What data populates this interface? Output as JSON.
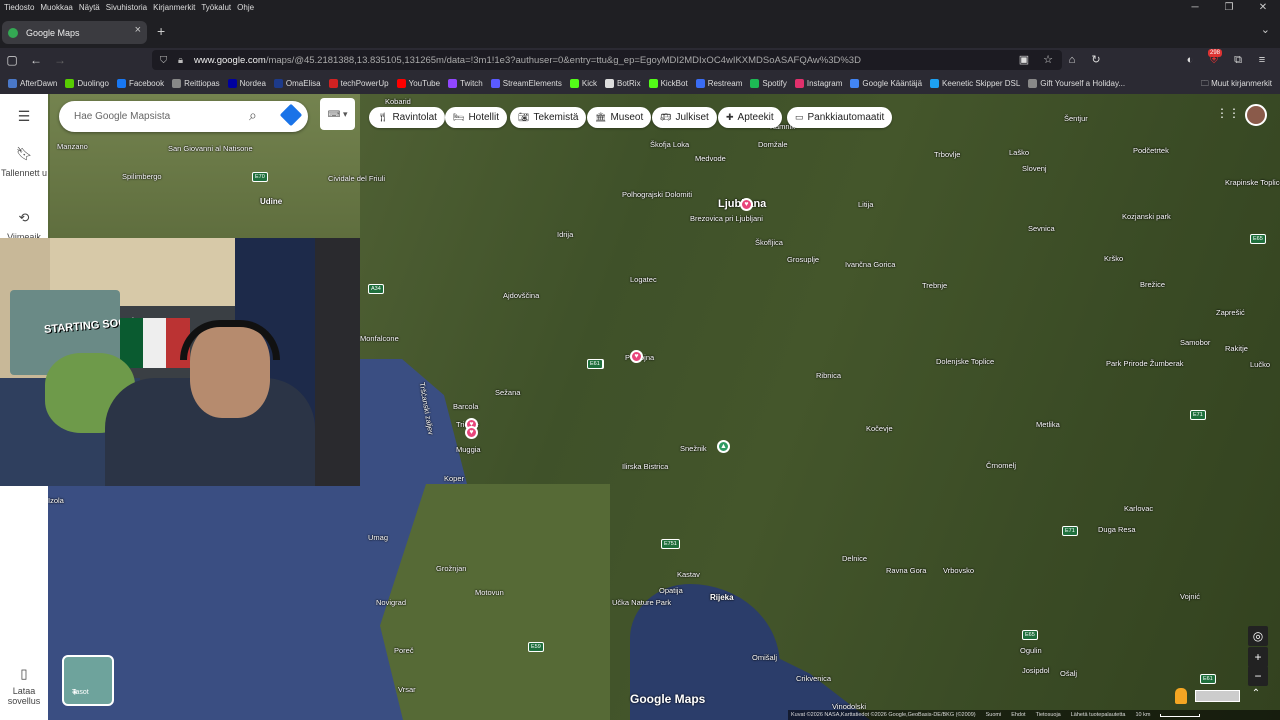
{
  "menubar": {
    "items": [
      "Tiedosto",
      "Muokkaa",
      "Näytä",
      "Sivuhistoria",
      "Kirjanmerkit",
      "Työkalut",
      "Ohje"
    ]
  },
  "window": {
    "minimize": "─",
    "restore": "❐",
    "close": "✕"
  },
  "tab": {
    "title": "Google Maps",
    "close": "×",
    "new_tab": "+",
    "list": "⌄"
  },
  "address": {
    "host": "www.google.com",
    "path": "/maps/@45.2181388,13.835105,131265m/data=!3m1!1e3?authuser=0&entry=ttu&g_ep=EgoyMDI2MDIxOC4wIKXMDSoASAFQAw%3D%3D"
  },
  "nav": {
    "badge": "298"
  },
  "bookmarks": {
    "items": [
      {
        "label": "AfterDawn",
        "color": "#4a78c8"
      },
      {
        "label": "Duolingo",
        "color": "#58cc02"
      },
      {
        "label": "Facebook",
        "color": "#1877f2"
      },
      {
        "label": "Reittiopas",
        "color": "#888888"
      },
      {
        "label": "Nordea",
        "color": "#0000a0"
      },
      {
        "label": "OmaElisa",
        "color": "#1d3a8a"
      },
      {
        "label": "techPowerUp",
        "color": "#d22222"
      },
      {
        "label": "YouTube",
        "color": "#ff0000"
      },
      {
        "label": "Twitch",
        "color": "#9146ff"
      },
      {
        "label": "StreamElements",
        "color": "#5a5aff"
      },
      {
        "label": "Kick",
        "color": "#53fc18"
      },
      {
        "label": "BotRix",
        "color": "#dddddd"
      },
      {
        "label": "KickBot",
        "color": "#53fc18"
      },
      {
        "label": "Restream",
        "color": "#3a6cf4"
      },
      {
        "label": "Spotify",
        "color": "#1db954"
      },
      {
        "label": "Instagram",
        "color": "#e1306c"
      },
      {
        "label": "Google Kääntäjä",
        "color": "#4285f4"
      },
      {
        "label": "Keenetic Skipper DSL",
        "color": "#1da1f2"
      },
      {
        "label": "Gift Yourself a Holiday...",
        "color": "#888888"
      }
    ],
    "other": "Muut kirjanmerkit"
  },
  "sidebar": {
    "menu": "☰",
    "saved": "Tallennett u",
    "recent": "Viimeaik",
    "app": "Lataa sovellus"
  },
  "search": {
    "placeholder": "Hae Google Mapsista"
  },
  "chips": [
    "Ravintolat",
    "Hotellit",
    "Tekemistä",
    "Museot",
    "Julkiset",
    "Apteekit",
    "Pankkiautomaatit"
  ],
  "map": {
    "places": [
      {
        "name": "Kobarid"
      },
      {
        "name": "Manzano"
      },
      {
        "name": "San Giovanni al Natisone"
      },
      {
        "name": "Spilimbergo"
      },
      {
        "name": "Udine"
      },
      {
        "name": "Cividale del Friuli"
      },
      {
        "name": "Ljubljana"
      },
      {
        "name": "Škofja Loka"
      },
      {
        "name": "Medvode"
      },
      {
        "name": "Domžale"
      },
      {
        "name": "Kamnik"
      },
      {
        "name": "Polhograjski Dolomiti"
      },
      {
        "name": "Brezovica pri Ljubljani"
      },
      {
        "name": "Idrija"
      },
      {
        "name": "Logatec"
      },
      {
        "name": "Škofljica"
      },
      {
        "name": "Grosuplje"
      },
      {
        "name": "Ivančna Gorica"
      },
      {
        "name": "Trebnje"
      },
      {
        "name": "Litija"
      },
      {
        "name": "Trbovlje"
      },
      {
        "name": "Šentjur"
      },
      {
        "name": "Laško"
      },
      {
        "name": "Podčetrtek"
      },
      {
        "name": "Krapinske Toplice"
      },
      {
        "name": "Kozjanski park"
      },
      {
        "name": "Sevnica"
      },
      {
        "name": "Krško"
      },
      {
        "name": "Brežice"
      },
      {
        "name": "Zaprešić"
      },
      {
        "name": "Samobor"
      },
      {
        "name": "Rakitje"
      },
      {
        "name": "Lučko"
      },
      {
        "name": "Ajdovščina"
      },
      {
        "name": "Monfalcone"
      },
      {
        "name": "Postojna"
      },
      {
        "name": "Sežana"
      },
      {
        "name": "Trieste"
      },
      {
        "name": "Barcola"
      },
      {
        "name": "Muggia"
      },
      {
        "name": "Koper"
      },
      {
        "name": "Izola"
      },
      {
        "name": "Ribnica"
      },
      {
        "name": "Dolenjske Toplice"
      },
      {
        "name": "Park Prirode Žumberak"
      },
      {
        "name": "Kočevje"
      },
      {
        "name": "Metlika"
      },
      {
        "name": "Črnomelj"
      },
      {
        "name": "Karlovac"
      },
      {
        "name": "Duga Resa"
      },
      {
        "name": "Snežnik"
      },
      {
        "name": "Ilirska Bistrica"
      },
      {
        "name": "Umag"
      },
      {
        "name": "Grožnjan"
      },
      {
        "name": "Motovun"
      },
      {
        "name": "Novigrad"
      },
      {
        "name": "Poreč"
      },
      {
        "name": "Vrsar"
      },
      {
        "name": "Kastav"
      },
      {
        "name": "Opatija"
      },
      {
        "name": "Rijeka"
      },
      {
        "name": "Učka Nature Park"
      },
      {
        "name": "Delnice"
      },
      {
        "name": "Ravna Gora"
      },
      {
        "name": "Vrbovsko"
      },
      {
        "name": "Vojnić"
      },
      {
        "name": "Omišalj"
      },
      {
        "name": "Crikvenica"
      },
      {
        "name": "Vinodolski"
      },
      {
        "name": "Ogulin"
      },
      {
        "name": "Josipdol"
      },
      {
        "name": "Ošalj"
      },
      {
        "name": "Slovenj"
      }
    ],
    "shields": [
      "E70",
      "A34",
      "E61",
      "E61",
      "E751",
      "E65",
      "E71",
      "E71",
      "E59",
      "E65",
      "E61",
      "E751"
    ],
    "gulf": "Tršćanski zaljev"
  },
  "webcam": {
    "poster_text": "STARTING SOON"
  },
  "layers": {
    "label": "Tasot"
  },
  "controls": {
    "locate": "◎",
    "zoom_in": "+",
    "zoom_out": "−",
    "expand": "⌃"
  },
  "brand": "Google Maps",
  "attribution": {
    "imagery": "Kuvat ©2026 NASA,Karttatiedot ©2026 Google,GeoBasis-DE/BKG (©2009)",
    "links": [
      "Suomi",
      "Ehdot",
      "Tietosuoja",
      "Lähetä tuotepalautetta"
    ],
    "scale": "10 km"
  }
}
